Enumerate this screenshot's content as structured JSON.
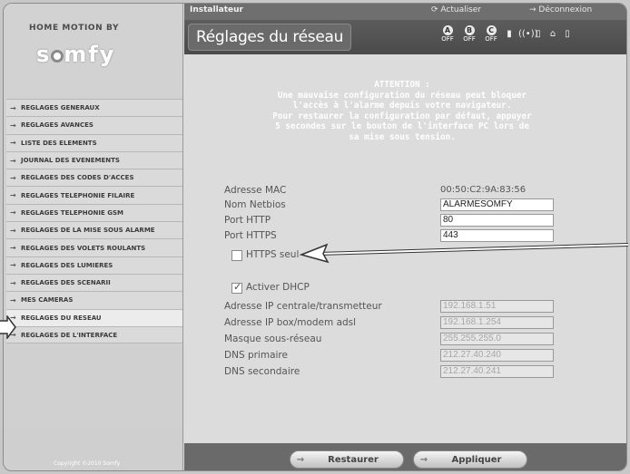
{
  "brand": {
    "top": "HOME MOTION BY",
    "name_a": "s",
    "name_b": "mfy"
  },
  "sidebar": {
    "items": [
      {
        "label": "REGLAGES GENERAUX"
      },
      {
        "label": "REGLAGES AVANCES"
      },
      {
        "label": "LISTE DES ELEMENTS"
      },
      {
        "label": "JOURNAL DES EVENEMENTS"
      },
      {
        "label": "REGLAGES DES CODES D'ACCES"
      },
      {
        "label": "REGLAGES TELEPHONIE FILAIRE"
      },
      {
        "label": "REGLAGES TELEPHONIE GSM"
      },
      {
        "label": "REGLAGES DE LA MISE SOUS ALARME"
      },
      {
        "label": "REGLAGES DES VOLETS ROULANTS"
      },
      {
        "label": "REGLAGES DES LUMIERES"
      },
      {
        "label": "REGLAGES DES SCENARII"
      },
      {
        "label": "MES CAMERAS"
      },
      {
        "label": "REGLAGES DU RESEAU"
      },
      {
        "label": "REGLAGES DE L'INTERFACE"
      }
    ],
    "active_index": 12,
    "copyright": "Copyright ©2010 Somfy"
  },
  "topbar": {
    "title": "Installateur",
    "refresh": "Actualiser",
    "logout": "Déconnexion"
  },
  "header": {
    "page_title": "Réglages du réseau",
    "zones": [
      {
        "letter": "A",
        "state": "OFF"
      },
      {
        "letter": "B",
        "state": "OFF"
      },
      {
        "letter": "C",
        "state": "OFF"
      }
    ]
  },
  "warning": {
    "title": "ATTENTION :",
    "lines": [
      "Une mauvaise configuration du réseau peut bloquer",
      "l'accès à l'alarme depuis votre navigateur.",
      "Pour restaurer la configuration par défaut, appuyer",
      "5 secondes sur le bouton de l'interface PC lors de",
      "sa mise sous tension."
    ]
  },
  "form": {
    "mac_label": "Adresse MAC",
    "mac_value": "00:50:C2:9A:83:56",
    "netbios_label": "Nom Netbios",
    "netbios_value": "ALARMESOMFY",
    "http_label": "Port HTTP",
    "http_value": "80",
    "https_label": "Port HTTPS",
    "https_value": "443",
    "https_only_label": "HTTPS seul",
    "https_only_checked": false,
    "dhcp_label": "Activer DHCP",
    "dhcp_checked": true,
    "ip_central_label": "Adresse IP centrale/transmetteur",
    "ip_central_value": "192.168.1.51",
    "ip_box_label": "Adresse IP box/modem adsl",
    "ip_box_value": "192.168.1.254",
    "mask_label": "Masque sous-réseau",
    "mask_value": "255.255.255.0",
    "dns1_label": "DNS primaire",
    "dns1_value": "212.27.40.240",
    "dns2_label": "DNS secondaire",
    "dns2_value": "212.27.40.241"
  },
  "footer": {
    "restore_label": "Restaurer",
    "apply_label": "Appliquer"
  }
}
